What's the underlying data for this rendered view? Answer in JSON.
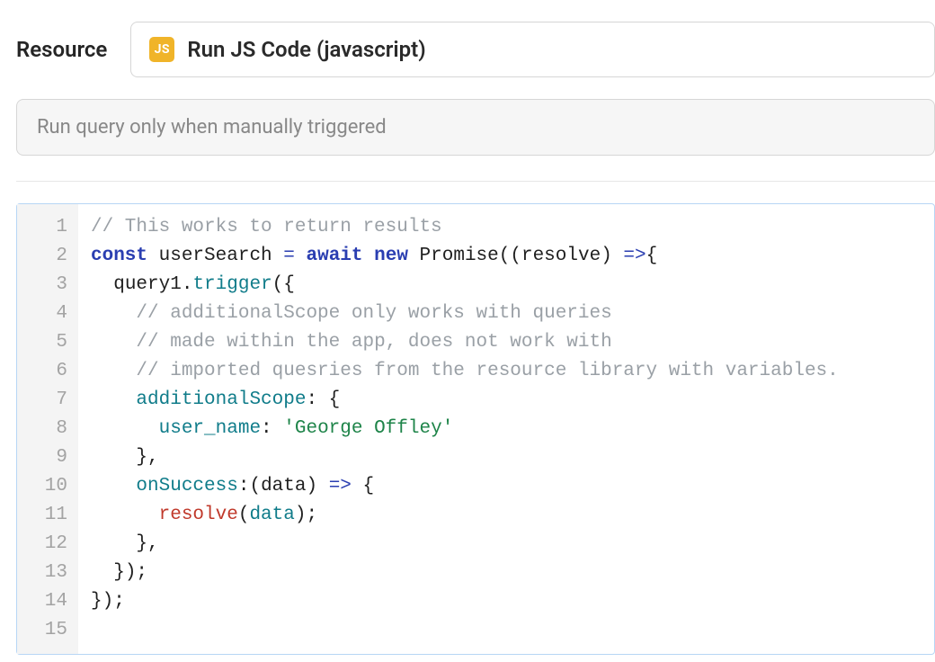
{
  "header": {
    "resource_label": "Resource",
    "js_icon_text": "JS",
    "resource_select_text": "Run JS Code (javascript)"
  },
  "trigger": {
    "text": "Run query only when manually triggered"
  },
  "editor": {
    "line_numbers": [
      "1",
      "2",
      "3",
      "4",
      "5",
      "6",
      "7",
      "8",
      "9",
      "10",
      "11",
      "12",
      "13",
      "14",
      "15"
    ],
    "lines": [
      [
        {
          "t": "comment",
          "v": "// This works to return results"
        }
      ],
      [
        {
          "t": "keyword",
          "v": "const"
        },
        {
          "t": "plain",
          "v": " "
        },
        {
          "t": "ident",
          "v": "userSearch"
        },
        {
          "t": "plain",
          "v": " "
        },
        {
          "t": "op",
          "v": "="
        },
        {
          "t": "plain",
          "v": " "
        },
        {
          "t": "keyword",
          "v": "await"
        },
        {
          "t": "plain",
          "v": " "
        },
        {
          "t": "keyword",
          "v": "new"
        },
        {
          "t": "plain",
          "v": " "
        },
        {
          "t": "ident",
          "v": "Promise"
        },
        {
          "t": "paren",
          "v": "(("
        },
        {
          "t": "ident",
          "v": "resolve"
        },
        {
          "t": "paren",
          "v": ") "
        },
        {
          "t": "arrow",
          "v": "=>"
        },
        {
          "t": "paren",
          "v": "{"
        }
      ],
      [
        {
          "t": "plain",
          "v": "  "
        },
        {
          "t": "ident",
          "v": "query1"
        },
        {
          "t": "paren",
          "v": "."
        },
        {
          "t": "prop",
          "v": "trigger"
        },
        {
          "t": "paren",
          "v": "({"
        }
      ],
      [
        {
          "t": "plain",
          "v": "    "
        },
        {
          "t": "comment",
          "v": "// additionalScope only works with queries"
        }
      ],
      [
        {
          "t": "plain",
          "v": "    "
        },
        {
          "t": "comment",
          "v": "// made within the app, does not work with"
        }
      ],
      [
        {
          "t": "plain",
          "v": "    "
        },
        {
          "t": "comment",
          "v": "// imported quesries from the resource library with variables."
        }
      ],
      [
        {
          "t": "plain",
          "v": "    "
        },
        {
          "t": "prop",
          "v": "additionalScope"
        },
        {
          "t": "paren",
          "v": ": {"
        }
      ],
      [
        {
          "t": "plain",
          "v": "      "
        },
        {
          "t": "prop",
          "v": "user_name"
        },
        {
          "t": "paren",
          "v": ": "
        },
        {
          "t": "string",
          "v": "'George Offley'"
        }
      ],
      [
        {
          "t": "plain",
          "v": "    "
        },
        {
          "t": "paren",
          "v": "},"
        }
      ],
      [
        {
          "t": "plain",
          "v": "    "
        },
        {
          "t": "prop",
          "v": "onSuccess"
        },
        {
          "t": "paren",
          "v": ":("
        },
        {
          "t": "ident",
          "v": "data"
        },
        {
          "t": "paren",
          "v": ") "
        },
        {
          "t": "arrow",
          "v": "=>"
        },
        {
          "t": "paren",
          "v": " {"
        }
      ],
      [
        {
          "t": "plain",
          "v": "      "
        },
        {
          "t": "call",
          "v": "resolve"
        },
        {
          "t": "paren",
          "v": "("
        },
        {
          "t": "arg",
          "v": "data"
        },
        {
          "t": "paren",
          "v": ");"
        }
      ],
      [
        {
          "t": "plain",
          "v": "    "
        },
        {
          "t": "paren",
          "v": "},"
        }
      ],
      [
        {
          "t": "plain",
          "v": "  "
        },
        {
          "t": "paren",
          "v": "});"
        }
      ],
      [
        {
          "t": "paren",
          "v": "});"
        }
      ],
      []
    ]
  }
}
